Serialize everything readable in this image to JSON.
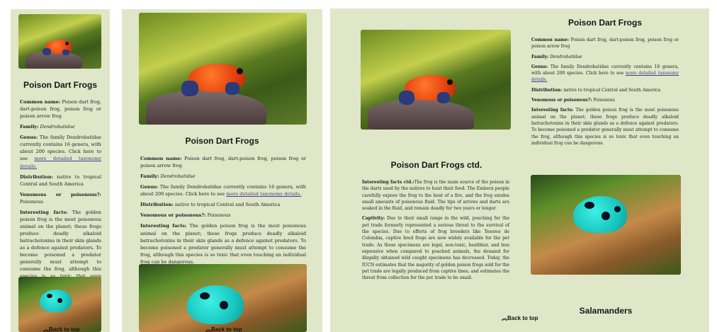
{
  "title": "Poison Dart Frogs",
  "labels": {
    "common_name": "Common name:",
    "family": "Family:",
    "genus": "Genus:",
    "distribution": "Distribution:",
    "venomous": "Venomous or poisonous?:",
    "interesting": "Interesting facts:"
  },
  "facts": {
    "common_name": "Poison dart frog, dart-poison frog, poison frog or poison arrow frog",
    "family": "Dendrobatidae",
    "genus_text": "The family Dendrobatidae currently contains 16 genera, with about 200 species. Click here to see",
    "genus_link": "more detailed taxonomy details.",
    "distribution": "native to tropical Central and South America",
    "venomous": "Poisonous",
    "interesting": "The golden poison frog is the most poisonous animal on the planet; these frogs produce deadly alkaloid batrachotoxins in their skin glands as a defence against predators. To become poisoned a predator generally must attempt to consume the frog, although this species is so toxic that even touching an individual frog can be dangerous."
  },
  "continued": {
    "title": "Poison Dart Frogs ctd.",
    "interesting_label": "Interesting facts ctd.:",
    "interesting": "The frog is the main source of the poison in the darts used by the natives to hunt their food. The Emberá people carefully expose the frog to the heat of a fire, and the frog exudes small amounts of poisonous fluid. The tips of arrows and darts are soaked in the fluid, and remain deadly for two years or longer.",
    "captivity_label": "Captivity:",
    "captivity": "Due to their small range in the wild, poaching for the pet trade formerly represented a serious threat to the survival of the species. Due to efforts of frog breeders like Tesoros de Colombia, captive bred frogs are now widely available for the pet trade. As these specimens are legal, non-toxic, healthier, and less expensive when compared to poached animals, the demand for illegally obtained wild caught specimens has decreased. Today, the IUCN estimates that the majority of golden poison frogs sold for the pet trade are legally produced from captive lines, and estimates the threat from collection for the pet trade to be small."
  },
  "next_section": "Salamanders",
  "back_to_top": "Back to top",
  "icons": {
    "back_to_top": "double-chevron-up-icon"
  },
  "colors": {
    "panel_bg": "#dfe7c8",
    "link": "#4b3a8a"
  }
}
